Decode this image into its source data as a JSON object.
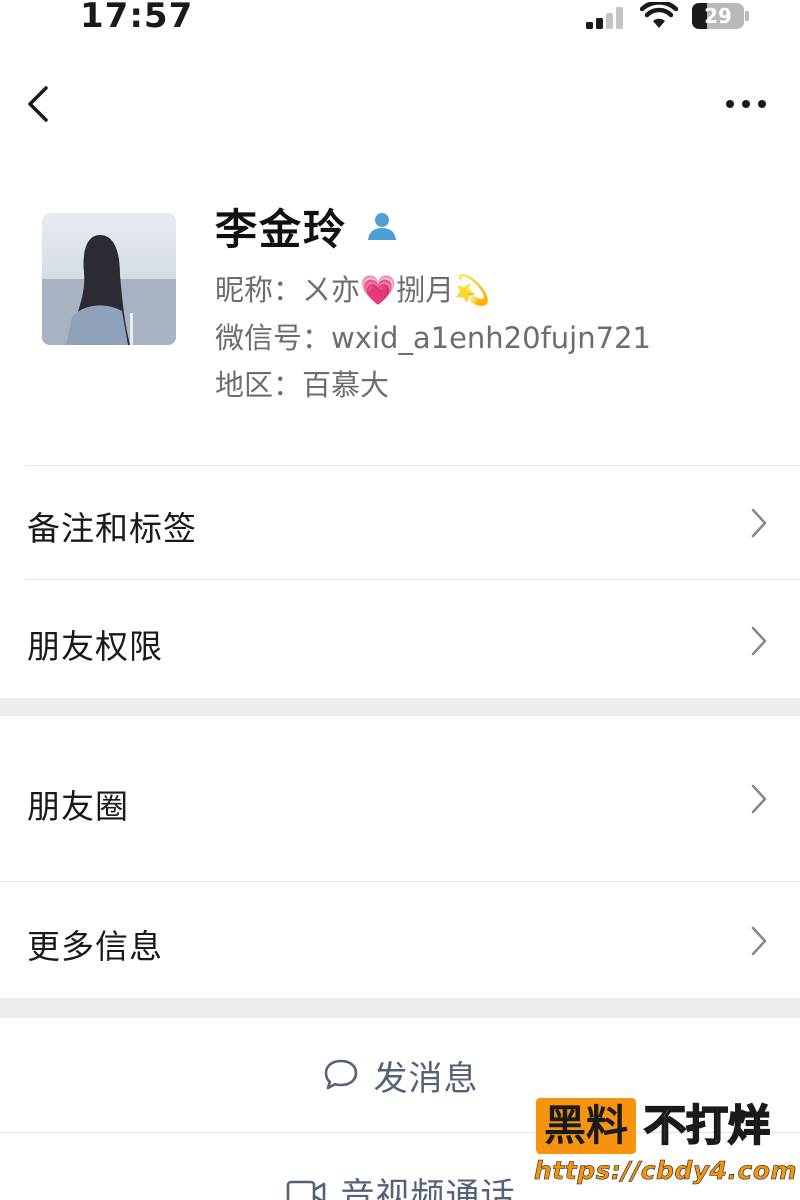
{
  "status_bar": {
    "time": "17:57",
    "battery_level": "29",
    "battery_fraction": 0.29
  },
  "nav": {
    "back_icon": "chevron-left-icon",
    "more_icon": "ellipsis-icon"
  },
  "profile": {
    "name": "李金玲",
    "contact_icon": "person-icon",
    "nickname_label": "昵称：",
    "nickname_value": "ㄨ亦💗捌月💫",
    "wechat_id_label": "微信号：",
    "wechat_id_value": "wxid_a1enh20fujn721",
    "region_label": "地区：",
    "region_value": "百慕大"
  },
  "menu_group_1": [
    {
      "label": "备注和标签"
    },
    {
      "label": "朋友权限"
    }
  ],
  "menu_group_2": [
    {
      "label": "朋友圈"
    },
    {
      "label": "更多信息"
    }
  ],
  "actions": {
    "send_message": "发消息",
    "send_message_icon": "chat-bubble-icon",
    "av_call": "音视频通话",
    "av_call_icon": "video-camera-icon"
  },
  "watermark": {
    "brand": "黑料",
    "tagline": "不打烊",
    "url": "https://cbdy4.com"
  },
  "colors": {
    "action_text": "#546178",
    "separator_band": "#ededed",
    "contact_icon": "#4f9fd6",
    "watermark_orange": "#f6940f"
  }
}
